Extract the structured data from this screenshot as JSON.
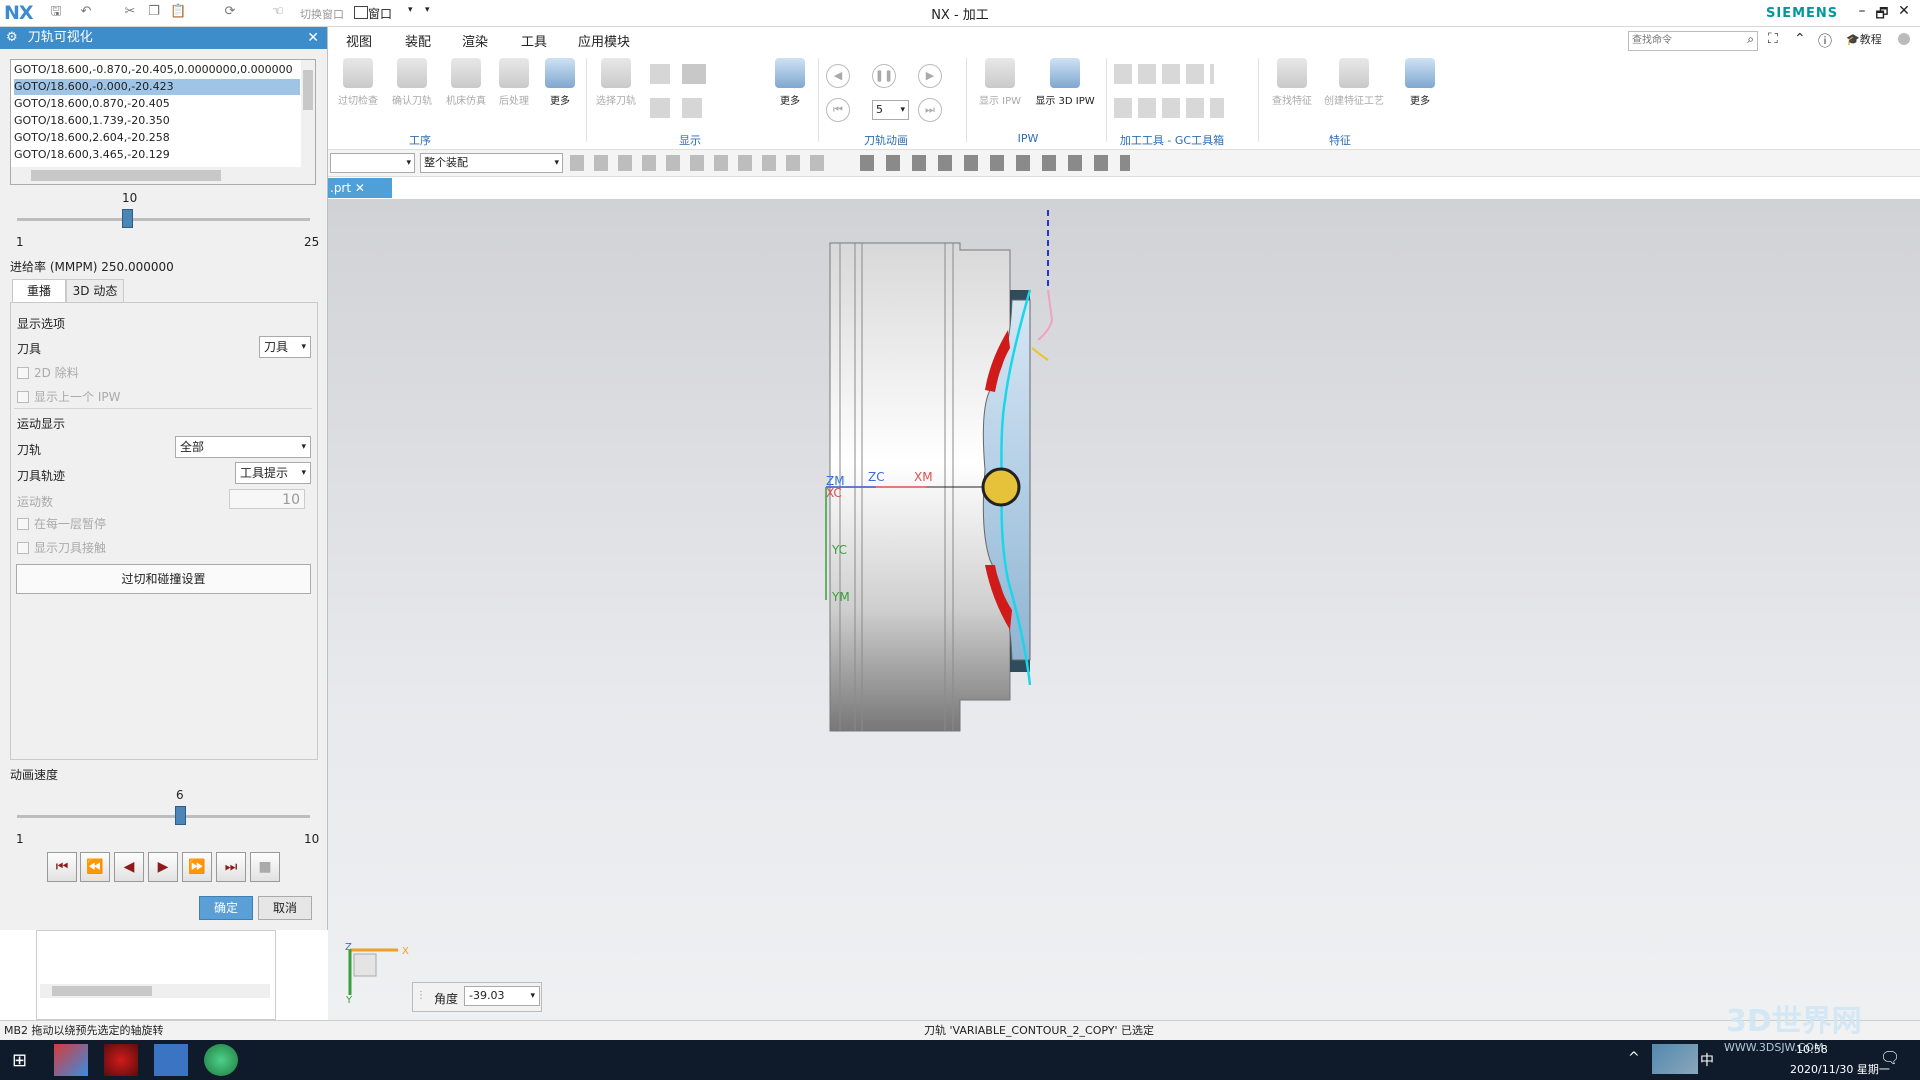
{
  "title_bar": {
    "logo": "NX",
    "switch_window": "切换窗口",
    "window_menu": "窗口",
    "title": "NX - 加工",
    "brand": "SIEMENS",
    "minimize": "–",
    "restore": "🗗",
    "close": "✕"
  },
  "menu": {
    "items": [
      "视图",
      "装配",
      "渲染",
      "工具",
      "应用模块"
    ],
    "search_placeholder": "查找命令",
    "tutorial": "教程"
  },
  "ribbon": {
    "procedure": {
      "buttons": [
        "过切检查",
        "确认刀轨",
        "机床仿真",
        "后处理",
        "更多"
      ],
      "group": "工序"
    },
    "display": {
      "buttons": [
        "选择刀轨",
        "更多"
      ],
      "group": "显示"
    },
    "animation": {
      "speed_value": "5",
      "group": "刀轨动画"
    },
    "ipw": {
      "buttons": [
        "显示 IPW",
        "显示 3D IPW"
      ],
      "group": "IPW"
    },
    "gc_toolbox": {
      "group": "加工工具 - GC工具箱"
    },
    "feature": {
      "buttons": [
        "查找特征",
        "创建特征工艺",
        "更多"
      ],
      "group": "特征"
    }
  },
  "filter_bar": {
    "assembly_scope": "整个装配"
  },
  "document_tab": {
    "name": ".prt"
  },
  "dialog": {
    "title": "刀轨可视化",
    "gcode_lines": [
      "GOTO/18.600,-0.870,-20.405,0.0000000,0.000000",
      "GOTO/18.600,-0.000,-20.423",
      "GOTO/18.600,0.870,-20.405",
      "GOTO/18.600,1.739,-20.350",
      "GOTO/18.600,2.604,-20.258",
      "GOTO/18.600,3.465,-20.129"
    ],
    "selected_line_index": 1,
    "position_slider": {
      "value": "10",
      "min": "1",
      "max": "25",
      "level": 0.375
    },
    "feed_rate": "进给率 (MMPM) 250.000000",
    "tabs": [
      "重播",
      "3D 动态"
    ],
    "display_options_header": "显示选项",
    "tool_label": "刀具",
    "tool_value": "刀具",
    "checkbox_2d_stock": "2D 除料",
    "checkbox_prev_ipw": "显示上一个 IPW",
    "motion_display_header": "运动显示",
    "toolpath_label": "刀轨",
    "toolpath_value": "全部",
    "tool_trace_label": "刀具轨迹",
    "tool_trace_value": "工具提示",
    "motion_count_label": "运动数",
    "motion_count_value": "10",
    "checkbox_pause_layer": "在每一层暂停",
    "checkbox_tool_contact": "显示刀具接触",
    "gouge_button": "过切和碰撞设置",
    "anim_speed_label": "动画速度",
    "speed_slider": {
      "value": "6",
      "min": "1",
      "max": "10",
      "level": 0.556
    },
    "ok": "确定",
    "cancel": "取消"
  },
  "viewport": {
    "axis_labels": [
      "ZM",
      "XC",
      "ZC",
      "XM",
      "YC",
      "YM"
    ],
    "triad": {
      "x": "X",
      "y": "Y",
      "z": "Z"
    },
    "angle_label": "角度",
    "angle_value": "-39.03"
  },
  "status_bar": {
    "left": "MB2 拖动以绕预先选定的轴旋转",
    "center": "刀轨 'VARIABLE_CONTOUR_2_COPY' 已选定"
  },
  "taskbar": {
    "time": "10:58",
    "date": "2020/11/30 星期一",
    "ime": "中",
    "watermark": "3D世界网",
    "watermark_url": "WWW.3DSJW.COM"
  },
  "colors": {
    "accent": "#3d8dcb",
    "cutter": "#e5c23a",
    "path": "#19d7e8",
    "stock_red": "#d11a1a"
  }
}
